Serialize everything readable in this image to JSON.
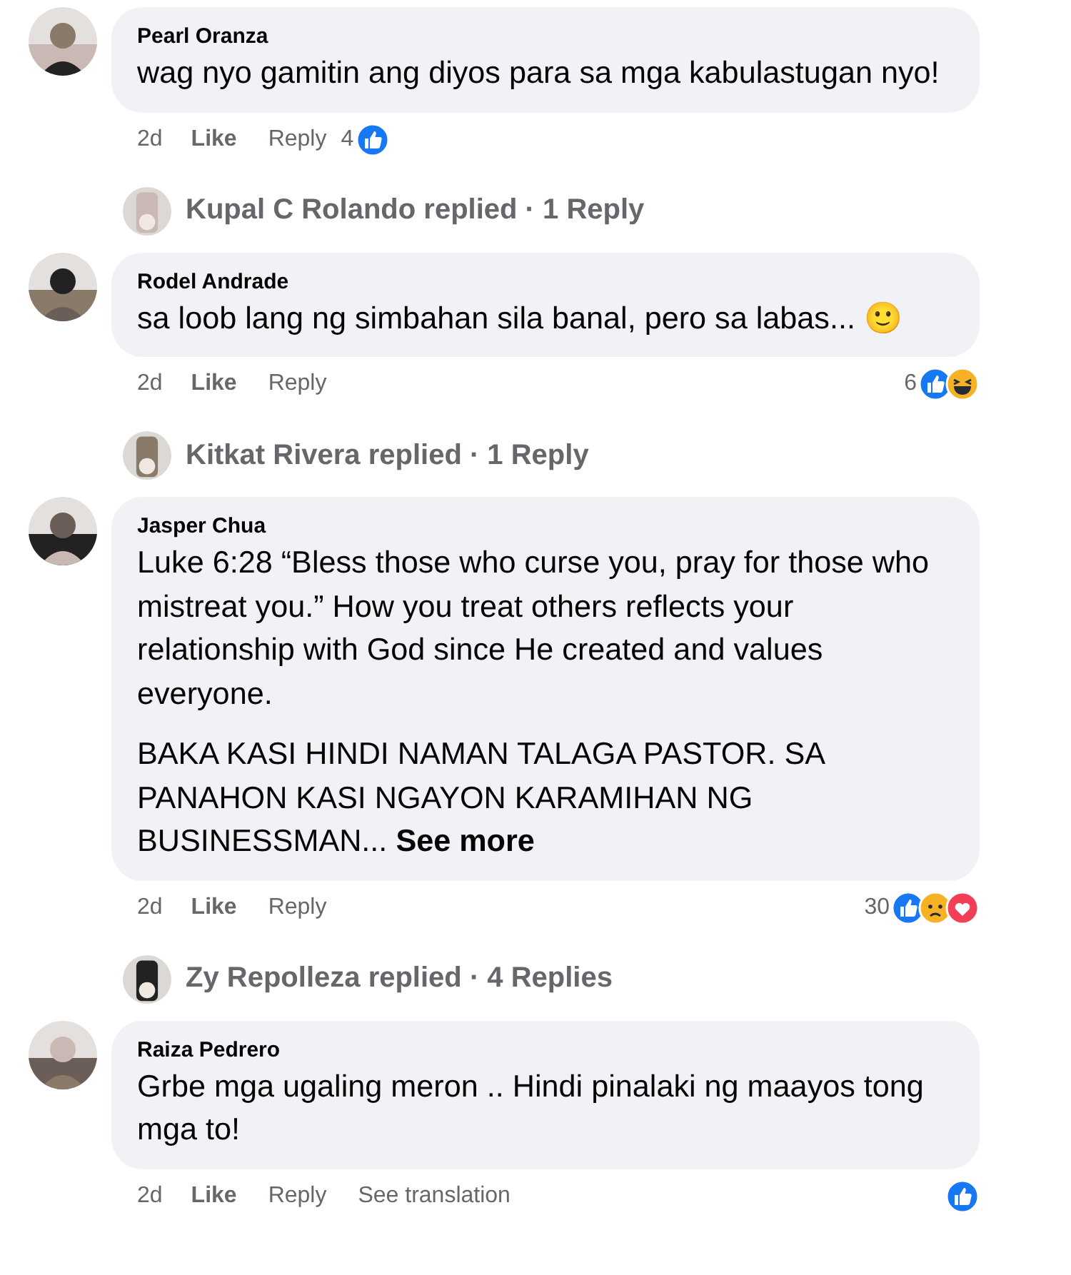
{
  "items": [
    {
      "kind": "comment",
      "author": "Pearl Oranza",
      "paragraphs": [
        "wag nyo gamitin ang diyos para sa mga kabulastugan nyo!"
      ],
      "time": "2d",
      "actions": [
        "Like",
        "Reply"
      ],
      "reaction_count": "4",
      "reactions_inline": true,
      "reactions": [
        {
          "kind": "like"
        }
      ]
    },
    {
      "kind": "replies",
      "text": "Kupal C Rolando replied · 1 Reply"
    },
    {
      "kind": "comment",
      "author": "Rodel Andrade",
      "paragraphs": [
        "sa loob lang ng simbahan sila banal, pero sa labas... 🙂"
      ],
      "time": "2d",
      "actions": [
        "Like",
        "Reply"
      ],
      "reaction_count": "6",
      "reactions_inline": false,
      "reactions": [
        {
          "kind": "like"
        },
        {
          "kind": "haha"
        }
      ]
    },
    {
      "kind": "replies",
      "text": "Kitkat Rivera replied · 1 Reply"
    },
    {
      "kind": "comment",
      "author": "Jasper Chua",
      "paragraphs": [
        "Luke 6:28 “Bless those who curse you, pray for those who mistreat you.” How you treat others reflects your relationship with God since He created and values everyone.",
        "BAKA KASI HINDI NAMAN TALAGA PASTOR. SA PANAHON KASI NGAYON KARAMIHAN NG BUSINESSMAN..."
      ],
      "see_more": "See more",
      "time": "2d",
      "actions": [
        "Like",
        "Reply"
      ],
      "reaction_count": "30",
      "reactions_inline": false,
      "reactions": [
        {
          "kind": "like"
        },
        {
          "kind": "sad"
        },
        {
          "kind": "love"
        }
      ]
    },
    {
      "kind": "replies",
      "text": "Zy Repolleza replied · 4 Replies"
    },
    {
      "kind": "comment",
      "author": "Raiza Pedrero",
      "paragraphs": [
        "Grbe mga ugaling meron .. Hindi pinalaki ng maayos tong mga to!"
      ],
      "time": "2d",
      "actions": [
        "Like",
        "Reply"
      ],
      "extra_action": "See translation",
      "reactions_inline": false,
      "reactions": [
        {
          "kind": "like"
        }
      ]
    }
  ]
}
